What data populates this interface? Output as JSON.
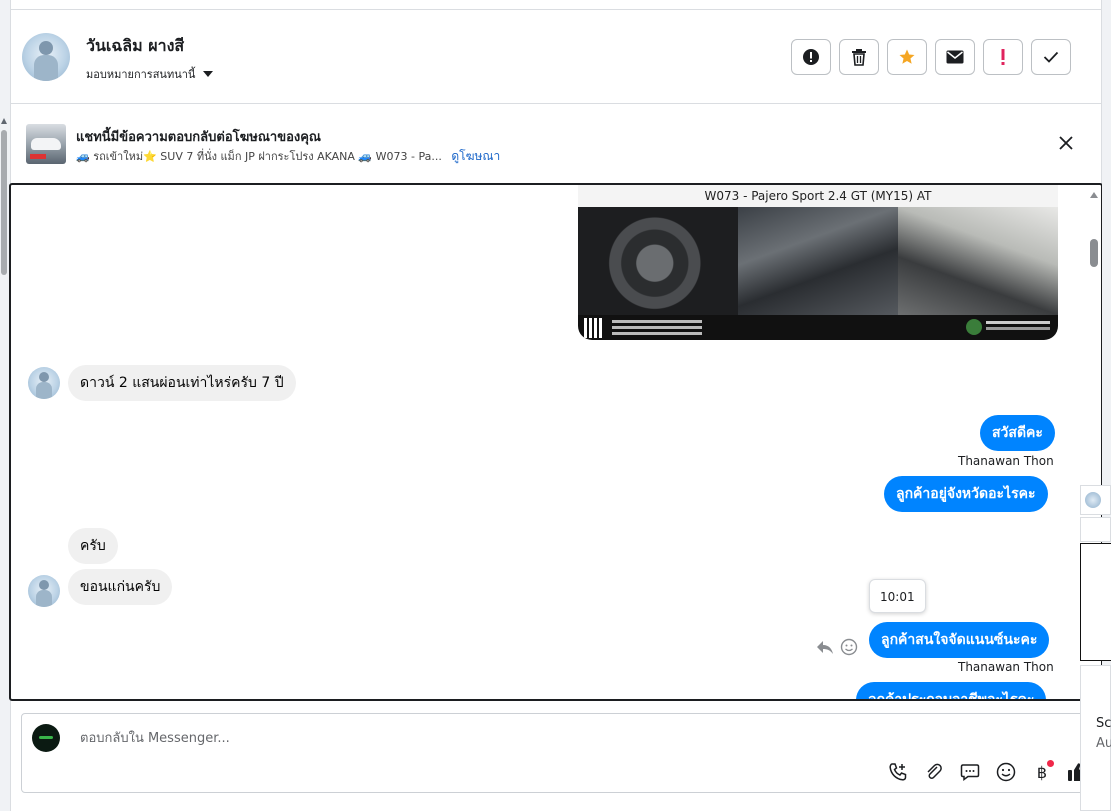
{
  "header": {
    "name": "วันเฉลิม ผางสี",
    "assign_label": "มอบหมายการสนทนานี้",
    "actions": [
      {
        "id": "info",
        "icon": "exclamation-circle-icon"
      },
      {
        "id": "delete",
        "icon": "trash-icon"
      },
      {
        "id": "star",
        "icon": "star-icon"
      },
      {
        "id": "mark-unread",
        "icon": "envelope-icon"
      },
      {
        "id": "spam",
        "icon": "exclamation-icon"
      },
      {
        "id": "done",
        "icon": "check-icon"
      }
    ]
  },
  "ad_banner": {
    "title": "แชทนี้มีข้อความตอบกลับต่อโฆษณาของคุณ",
    "subtitle": "🚙 รถเข้าใหม่⭐ SUV 7 ที่นั่ง แม็ก JP ฝากระโปรง AKANA 🚙 W073 - Pa...",
    "link": "ดูโฆษณา"
  },
  "conversation": {
    "image_caption": "W073 - Pajero Sport 2.4 GT (MY15) AT",
    "messages": [
      {
        "dir": "in",
        "text": "ดาวน์ 2 แสนผ่อนเท่าไหร่ครับ 7 ปี"
      },
      {
        "dir": "out",
        "text": "สวัสดีคะ",
        "sender": "Thanawan Thon"
      },
      {
        "dir": "out",
        "text": "ลูกค้าอยู่จังหวัดอะไรคะ"
      },
      {
        "dir": "in",
        "text": "ครับ"
      },
      {
        "dir": "in",
        "text": "ขอนแก่นครับ"
      },
      {
        "dir": "out",
        "text": "ลูกค้าสนใจจัดแนนซ์นะคะ",
        "sender": "Thanawan Thon",
        "tooltip": "10:01"
      },
      {
        "dir": "out",
        "text": "ลูกค้าประกอบอาชีพอะไรคะ"
      }
    ]
  },
  "composer": {
    "placeholder": "ตอบกลับใน Messenger...",
    "tools": [
      "phone-plus-icon",
      "paperclip-icon",
      "chat-bubble-icon",
      "emoji-icon",
      "baht-icon",
      "thumbs-up-icon"
    ],
    "baht_symbol": "฿"
  },
  "side_peek": {
    "text1": "Sc",
    "text2": "Au"
  },
  "colors": {
    "accent": "#0084ff",
    "star": "#f5a623",
    "spam": "#e0245e",
    "link": "#1b66c9"
  }
}
